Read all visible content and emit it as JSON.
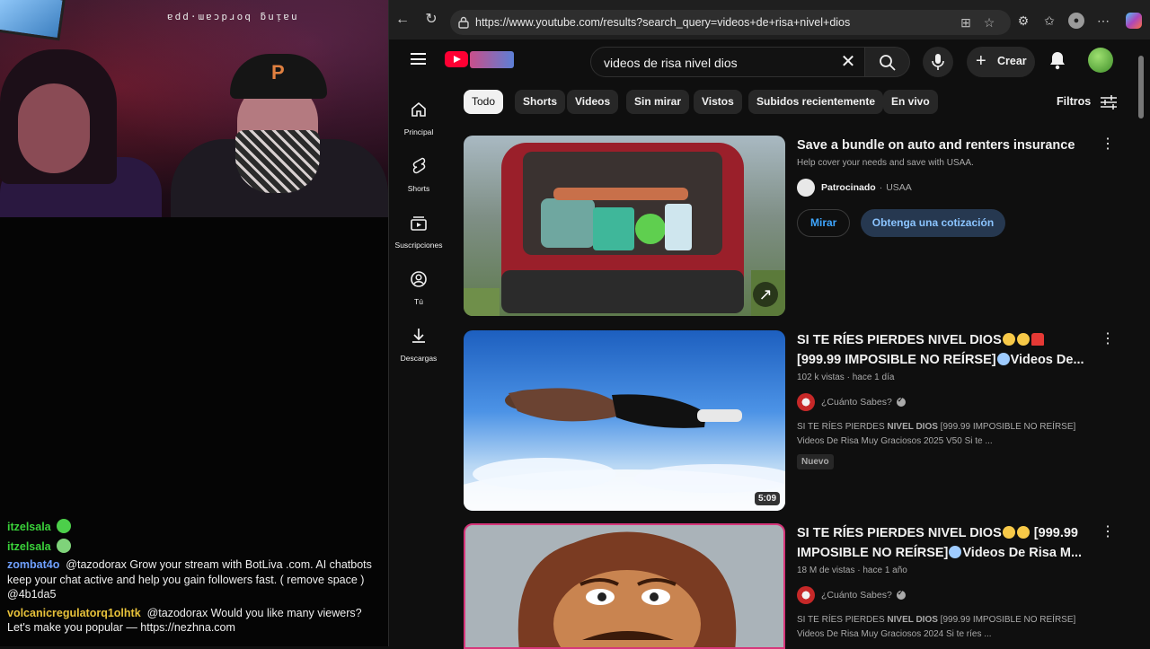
{
  "stream": {
    "overlay_text": "ɐdd·ɯɐɔpɹoq ƃuᴉɐu",
    "chat": [
      {
        "user": "itzelsala",
        "user_color": "#3ad13a",
        "text": "",
        "emote": "green-emote"
      },
      {
        "user": "itzelsala",
        "user_color": "#3ad13a",
        "text": "",
        "emote": "green-emote-2"
      },
      {
        "user": "zombat4o",
        "user_color": "#6fa0ff",
        "text": "@tazodorax Grow your stream with BotLiva .com. AI chatbots keep your chat active and help you gain followers fast. ( remove space ) @4b1da5"
      },
      {
        "user": "volcanicregulatorq1olhtk",
        "user_color": "#e8c23a",
        "text": "@tazodorax Would you like many viewers? Let's make you popular — https://nezhna.com"
      }
    ]
  },
  "browser": {
    "url": "https://www.youtube.com/results?search_query=videos+de+risa+nivel+dios"
  },
  "youtube": {
    "search_query": "videos de risa nivel dios",
    "create_label": "Crear",
    "filters_label": "Filtros",
    "sidebar": [
      {
        "label": "Principal",
        "icon": "home-icon"
      },
      {
        "label": "Shorts",
        "icon": "shorts-icon"
      },
      {
        "label": "Suscripciones",
        "icon": "subscriptions-icon"
      },
      {
        "label": "Tú",
        "icon": "you-icon"
      },
      {
        "label": "Descargas",
        "icon": "download-icon"
      }
    ],
    "chips": [
      "Todo",
      "Shorts",
      "Videos",
      "Sin mirar",
      "Vistos",
      "Subidos recientemente",
      "En vivo"
    ],
    "ad": {
      "title": "Save a bundle on auto and renters insurance",
      "description": "Help cover your needs and save with USAA.",
      "sponsored": "Patrocinado",
      "advertiser": "USAA",
      "watch_label": "Mirar",
      "quote_label": "Obtenga una cotización"
    },
    "results": [
      {
        "title_a": "SI TE RÍES PIERDES NIVEL DIOS",
        "title_b": "[999.99 IMPOSIBLE NO REÍRSE]",
        "title_c": "Videos De...",
        "views": "102 k vistas",
        "age": "hace 1 día",
        "channel": "¿Cuánto Sabes?",
        "desc_a": "SI TE RÍES PIERDES ",
        "desc_bold": "NIVEL DIOS",
        "desc_b": " [999.99 IMPOSIBLE NO REÍRSE] Videos De Risa Muy Graciosos 2025 V50 Si te ...",
        "badge": "Nuevo",
        "duration": "5:09"
      },
      {
        "title_a": "SI TE RÍES PIERDES NIVEL DIOS",
        "title_b": "[999.99 IMPOSIBLE NO REÍRSE]",
        "title_c": "Videos De Risa M...",
        "views": "18 M de vistas",
        "age": "hace 1 año",
        "channel": "¿Cuánto Sabes?",
        "desc_a": "SI TE RÍES PIERDES ",
        "desc_bold": "NIVEL DIOS",
        "desc_b": " [999.99 IMPOSIBLE NO REÍRSE] Videos De Risa Muy Graciosos 2024 Si te ríes ..."
      }
    ]
  },
  "colors": {
    "youtube_red": "#ff0033",
    "link_blue": "#3ea6ff",
    "background": "#0f0f0f"
  }
}
